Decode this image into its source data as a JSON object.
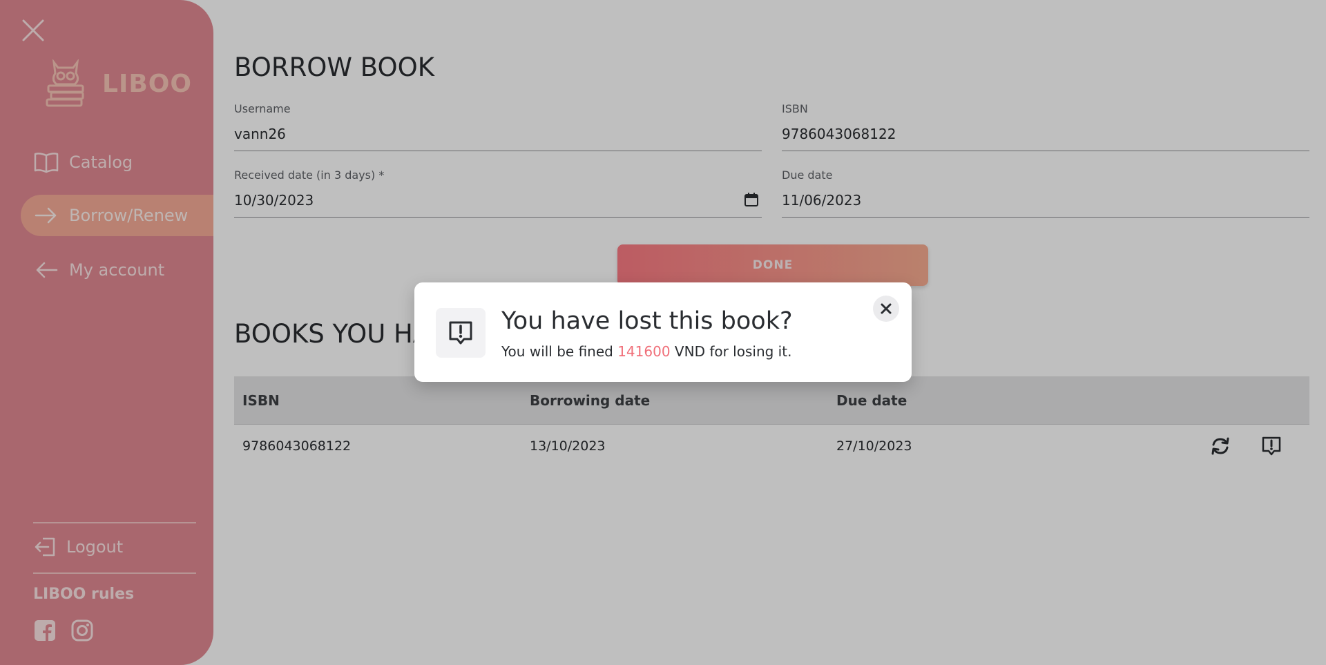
{
  "sidebar": {
    "brand": "LIBOO",
    "nav": [
      {
        "label": "Catalog",
        "icon": "book-open-icon"
      },
      {
        "label": "Borrow/Renew",
        "icon": "arrow-right-icon",
        "active": true
      },
      {
        "label": "My account",
        "icon": "arrow-left-icon"
      }
    ],
    "logout_label": "Logout",
    "rules_label": "LIBOO rules"
  },
  "page": {
    "title": "BORROW BOOK",
    "form": {
      "username_label": "Username",
      "username_value": "vann26",
      "isbn_label": "ISBN",
      "isbn_value": "9786043068122",
      "received_label": "Received date (in 3 days) *",
      "received_value": "10/30/2023",
      "due_label": "Due date",
      "due_value": "11/06/2023"
    },
    "done_label": "DONE",
    "section_title": "BOOKS YOU HAVE BORROWED",
    "table": {
      "headers": [
        "ISBN",
        "Borrowing date",
        "Due date"
      ],
      "rows": [
        {
          "isbn": "9786043068122",
          "borrowing_date": "13/10/2023",
          "due_date": "27/10/2023"
        }
      ]
    }
  },
  "modal": {
    "title": "You have lost this book?",
    "text_before": "You will be fined ",
    "amount": "141600",
    "text_after": " VND for losing it."
  },
  "colors": {
    "sidebar": "#e28a93",
    "active_nav": "#f7ad98",
    "accent": "#f06e78"
  }
}
